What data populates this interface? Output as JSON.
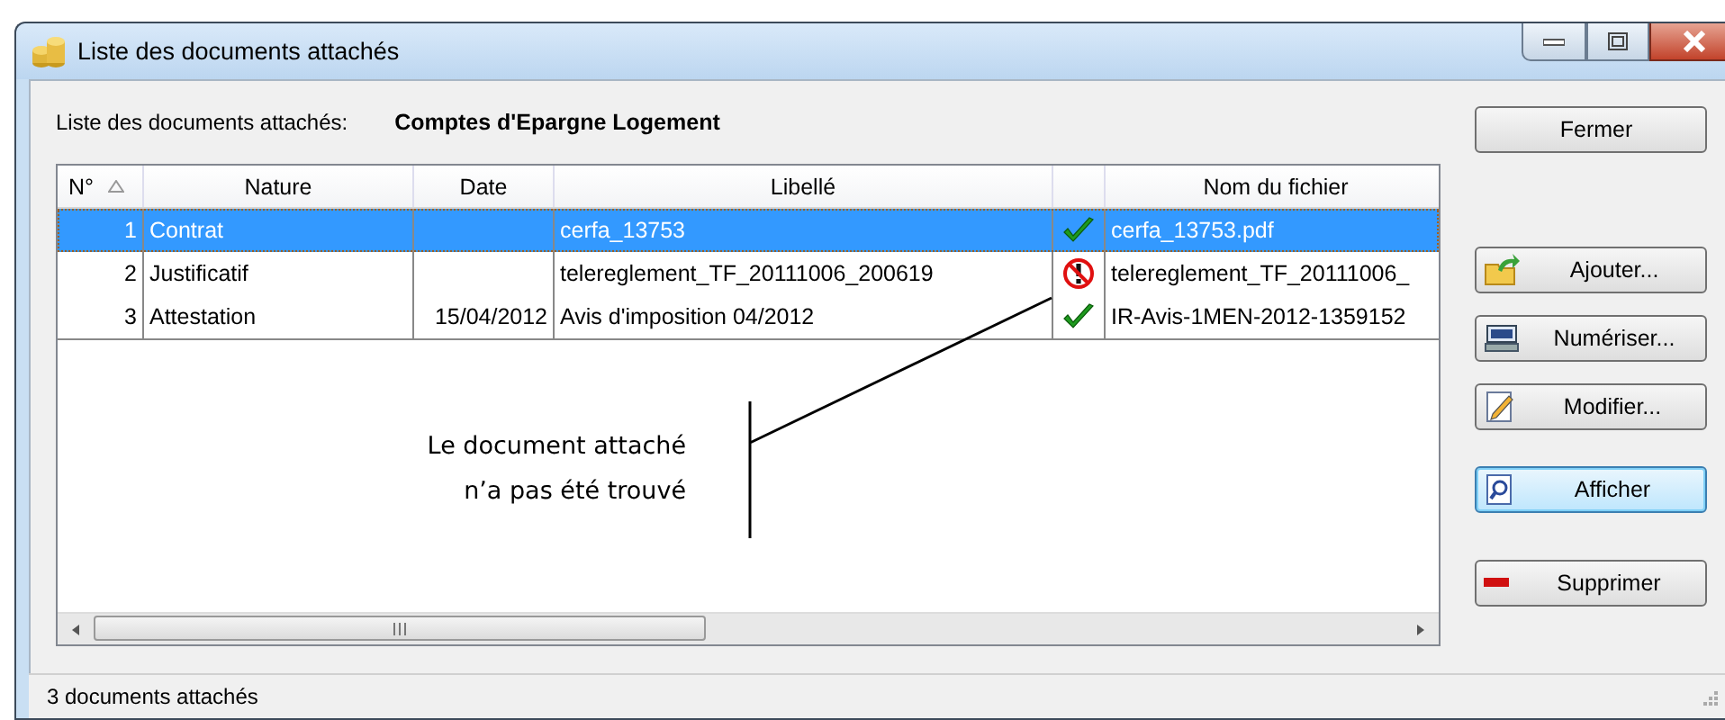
{
  "window": {
    "title": "Liste des documents attachés"
  },
  "header": {
    "label": "Liste des documents attachés:",
    "value": "Comptes d'Epargne Logement"
  },
  "table": {
    "columns": [
      {
        "label": "N°",
        "sorted": true
      },
      {
        "label": "Nature",
        "sorted": false
      },
      {
        "label": "Date",
        "sorted": false
      },
      {
        "label": "Libellé",
        "sorted": false
      },
      {
        "sorted": false
      },
      {
        "label": "Nom du fichier",
        "sorted": false
      }
    ],
    "rows": [
      {
        "number": "1",
        "nature": "Contrat",
        "date": "",
        "libelle": "cerfa_13753",
        "kind": "found",
        "file": "cerfa_13753.pdf",
        "selected": true
      },
      {
        "number": "2",
        "nature": "Justificatif",
        "date": "",
        "libelle": "telereglement_TF_20111006_200619",
        "kind": "missing",
        "file": "telereglement_TF_20111006_",
        "selected": false
      },
      {
        "number": "3",
        "nature": "Attestation",
        "date": "15/04/2012",
        "libelle": "Avis d'imposition 04/2012",
        "kind": "found",
        "file": "IR-Avis-1MEN-2012-1359152",
        "selected": false
      }
    ]
  },
  "annotation": {
    "lines": [
      "Le document attaché",
      "n’a pas été trouvé"
    ]
  },
  "buttons": [
    {
      "label": "Fermer",
      "kind": "plain",
      "default": false
    },
    {
      "label": "Ajouter...",
      "kind": "add",
      "default": false
    },
    {
      "label": "Numériser...",
      "kind": "scan",
      "default": false
    },
    {
      "label": "Modifier...",
      "kind": "edit",
      "default": false
    },
    {
      "label": "Afficher",
      "kind": "view",
      "default": true
    },
    {
      "label": "Supprimer",
      "kind": "delete",
      "default": false
    }
  ],
  "status_bar": {
    "text": "3 documents attachés"
  }
}
